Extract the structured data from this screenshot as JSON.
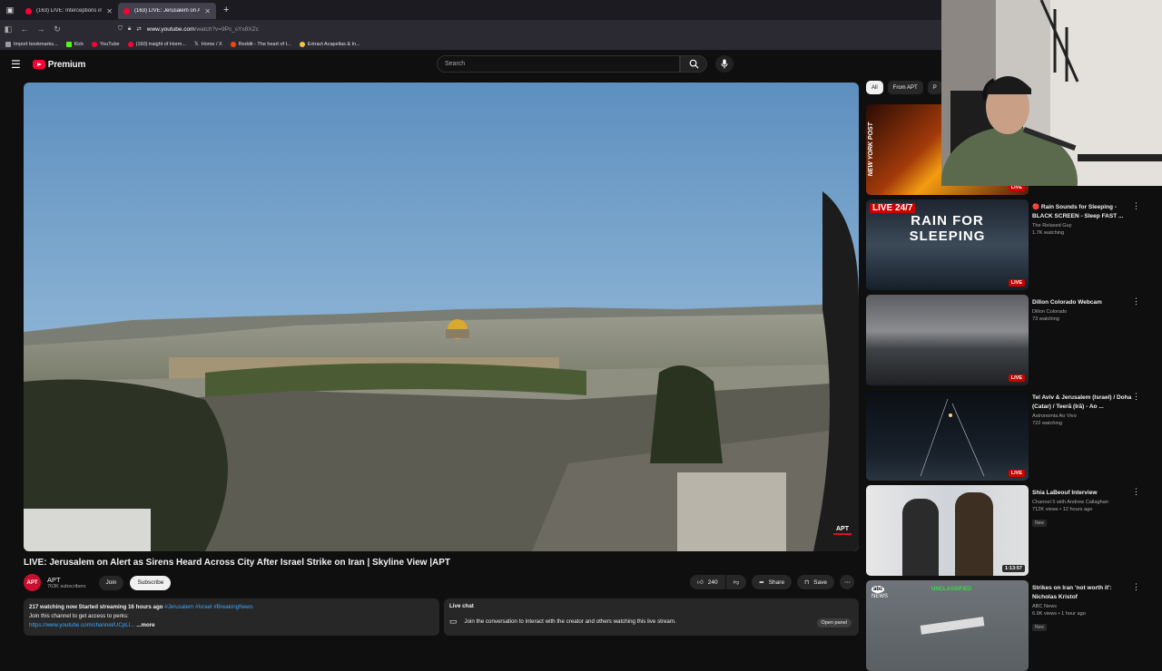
{
  "browser": {
    "tabs": [
      {
        "label": "(163) LIVE: Interceptions in Tel",
        "active": false
      },
      {
        "label": "(163) LIVE: Jerusalem on Alert a",
        "active": true
      }
    ],
    "url_domain": "www.youtube.com",
    "url_path": "/watch?v=9Pc_sYx8XZc",
    "bookmarks": [
      {
        "label": "Import bookmarks...",
        "color": "#9a9aa5"
      },
      {
        "label": "Kick",
        "color": "#53fc18"
      },
      {
        "label": "YouTube",
        "color": "#ff0033"
      },
      {
        "label": "(160) traight of Horm...",
        "color": "#ff0033"
      },
      {
        "label": "Home / X",
        "color": "#ffffff"
      },
      {
        "label": "Reddit - The heart of t...",
        "color": "#ff4500"
      },
      {
        "label": "Extract Acapellas & In...",
        "color": "#f5c542"
      }
    ]
  },
  "header": {
    "logo_text": "Premium",
    "search_placeholder": "Search"
  },
  "video": {
    "title": "LIVE: Jerusalem on Alert as Sirens Heard Across City After Israel Strike on Iran | Skyline View |APT",
    "watermark": "APT",
    "channel_avatar": "APT",
    "channel_name": "APT",
    "subscribers": "763K subscribers",
    "join_label": "Join",
    "subscribe_label": "Subscribe",
    "likes": "240",
    "share_label": "Share",
    "save_label": "Save"
  },
  "description": {
    "stats": "217 watching now  Started streaming 16 hours ago",
    "tags": "#Jerusalem #Israel #BreakingNews",
    "line2": "Join this channel to get access to perks:",
    "link": "https://www.youtube.com/channel/UCpLI...",
    "more": "...more"
  },
  "live_chat": {
    "title": "Live chat",
    "prompt": "Join the conversation to interact with the creator and others watching this live stream.",
    "open_label": "Open panel"
  },
  "chips": [
    "All",
    "From APT",
    "P"
  ],
  "recommendations": [
    {
      "title": "",
      "channel": "",
      "meta": "",
      "badge": "LIVE",
      "thumb_text": "NEW YORK POST",
      "thumb_style": "fire"
    },
    {
      "title": "🔴 Rain Sounds for Sleeping - BLACK SCREEN - Sleep FAST ...",
      "channel": "The Relaxed Guy",
      "meta": "1.7K watching",
      "badge": "LIVE",
      "thumb_text": "LIVE 24/7|RAIN FOR|SLEEPING",
      "thumb_style": "rain"
    },
    {
      "title": "Dillon Colorado Webcam",
      "channel": "Dillon Colorado",
      "meta": "73 watching",
      "badge": "LIVE",
      "thumb_text": "",
      "thumb_style": "mountain"
    },
    {
      "title": "Tel Aviv & Jerusalem (Israel) / Doha (Catar) / Teerã (Irã) - Ao ...",
      "channel": "Astronomia Ao Vivo",
      "meta": "722 watching",
      "badge": "LIVE",
      "thumb_text": "",
      "thumb_style": "night"
    },
    {
      "title": "Shia LaBeouf Interview",
      "channel": "Channel 5 with Andrew Callaghan",
      "meta": "712K views • 12 hours ago",
      "badge": "1:13:57",
      "new": "New",
      "thumb_text": "",
      "thumb_style": "people"
    },
    {
      "title": "Strikes on Iran 'not worth it': Nicholas Kristof",
      "channel": "ABC News",
      "meta": "6.9K views • 1 hour ago",
      "badge": "",
      "new": "New",
      "thumb_text": "abc NEWS|UNCLASSIFIED",
      "thumb_style": "aerial"
    }
  ]
}
